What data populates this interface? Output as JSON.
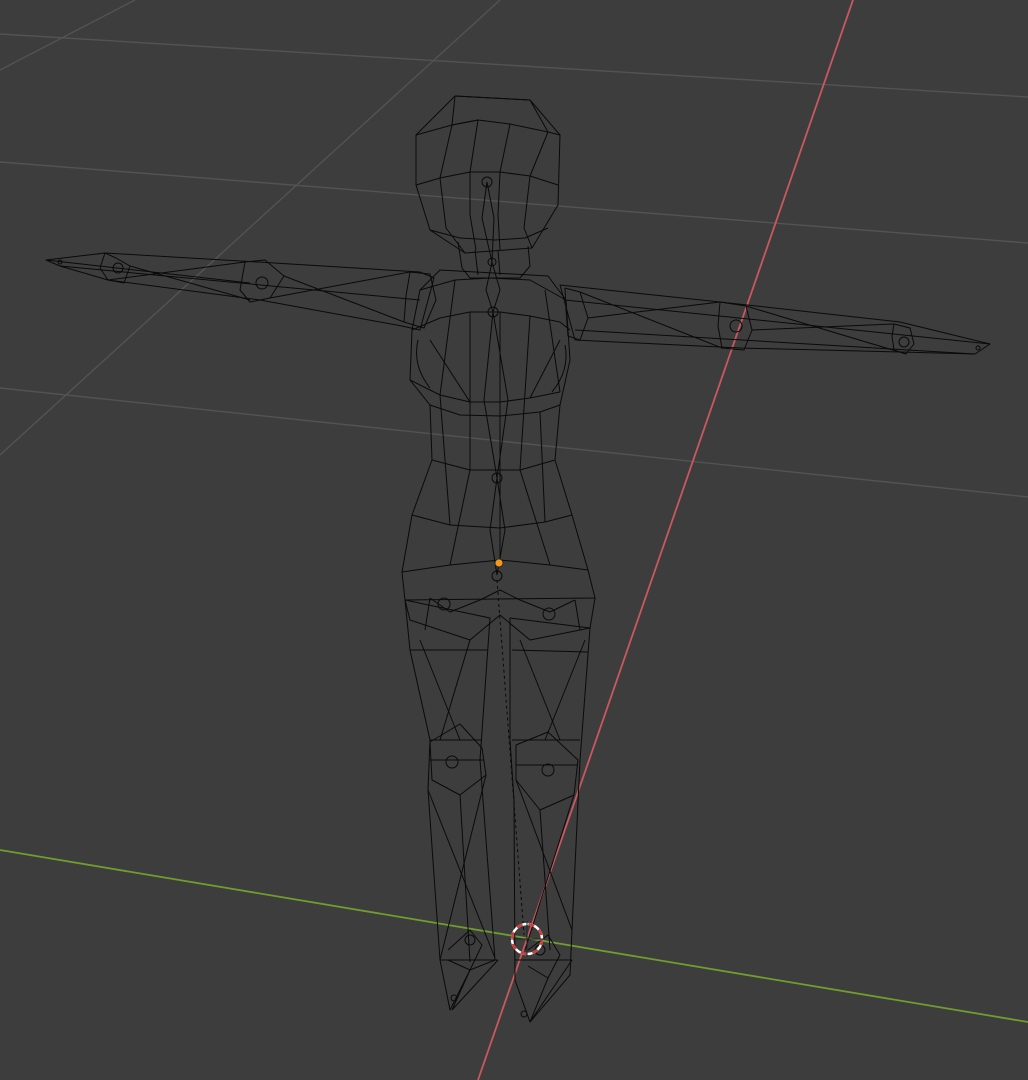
{
  "viewport": {
    "mode": "wireframe",
    "background_color": "#3d3d3d",
    "grid_color": "#535353",
    "x_axis_color": "#c9585f",
    "y_axis_color": "#6f9e2d",
    "wire_color": "#0a0a0a",
    "origin_color": "#f29a1c",
    "cursor_colors": [
      "#d23c3c",
      "#ffffff"
    ]
  },
  "scene": {
    "objects": [
      {
        "name": "character-mesh",
        "display": "wireframe",
        "pose": "T-pose"
      },
      {
        "name": "armature",
        "display": "octahedral-bones"
      },
      {
        "name": "3d-cursor"
      },
      {
        "name": "object-origin"
      }
    ]
  }
}
